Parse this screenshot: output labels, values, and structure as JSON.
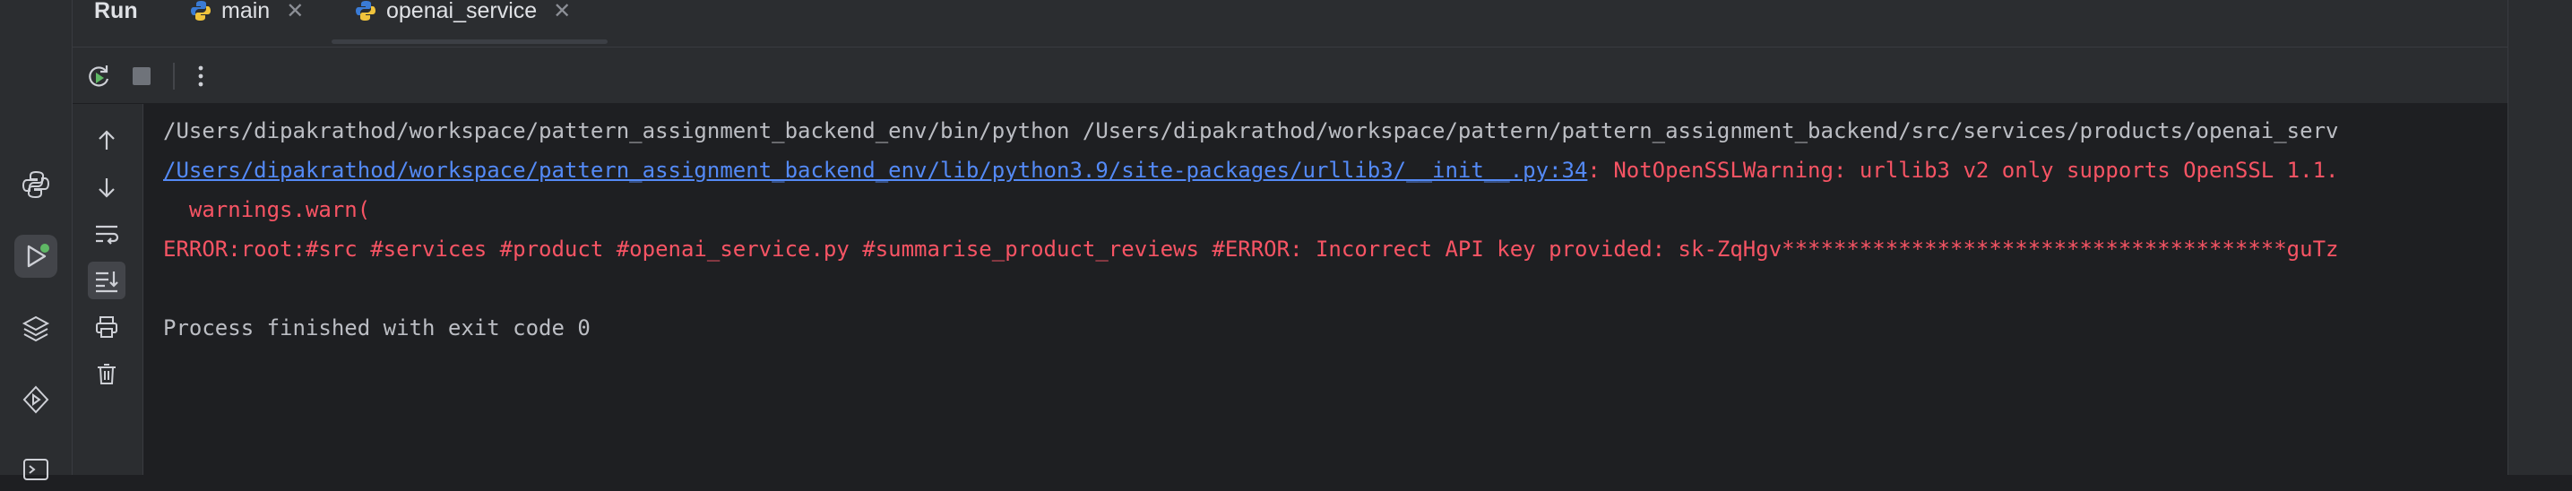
{
  "header": {
    "run_title": "Run",
    "tabs": [
      {
        "label": "main",
        "icon": "python-icon"
      },
      {
        "label": "openai_service",
        "icon": "python-icon",
        "active": true
      }
    ]
  },
  "console": {
    "lines": [
      "/Users/dipakrathod/workspace/pattern_assignment_backend_env/bin/python /Users/dipakrathod/workspace/pattern/pattern_assignment_backend/src/services/products/openai_serv",
      "/Users/dipakrathod/workspace/pattern_assignment_backend_env/lib/python3.9/site-packages/urllib3/__init__.py:34",
      ": NotOpenSSLWarning: urllib3 v2 only supports OpenSSL 1.1.",
      "  warnings.warn(",
      "ERROR:root:#src #services #product #openai_service.py #summarise_product_reviews #ERROR: Incorrect API key provided: sk-ZqHgv***************************************guTz",
      "Process finished with exit code 0"
    ]
  },
  "colors": {
    "error": "#f75464",
    "link": "#548af7",
    "text": "#bcbec4",
    "background": "#1e1f22"
  }
}
